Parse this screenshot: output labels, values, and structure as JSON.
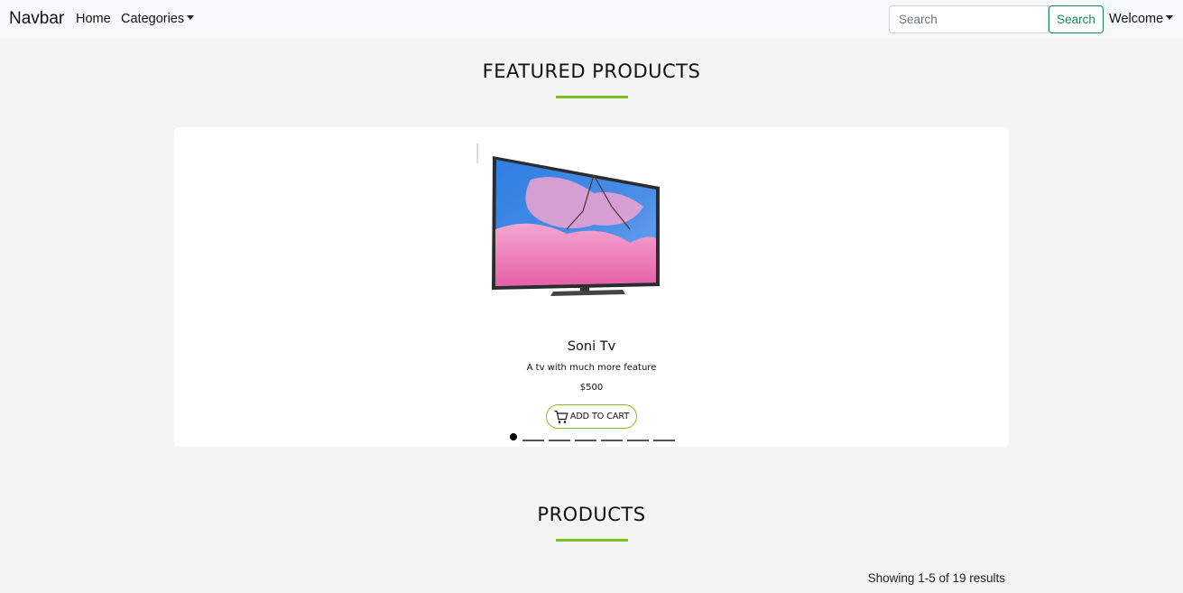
{
  "navbar": {
    "brand": "Navbar",
    "home": "Home",
    "categories": "Categories",
    "search_placeholder": "Search",
    "search_button": "Search",
    "welcome": "Welcome"
  },
  "featured": {
    "title": "FEATURED PRODUCTS",
    "product": {
      "name": "Soni Tv",
      "description": "A tv with much more feature",
      "price": "$500",
      "add_to_cart": "ADD TO CART"
    },
    "carousel": {
      "total_slides": 7,
      "active_index": 0
    }
  },
  "products": {
    "title": "PRODUCTS",
    "results_text": "Showing 1-5 of 19 results"
  },
  "colors": {
    "accent": "#7cbf1e",
    "search_button": "#198754",
    "navbar_bg": "#f8f9fa",
    "page_bg": "#f4f4f4"
  }
}
